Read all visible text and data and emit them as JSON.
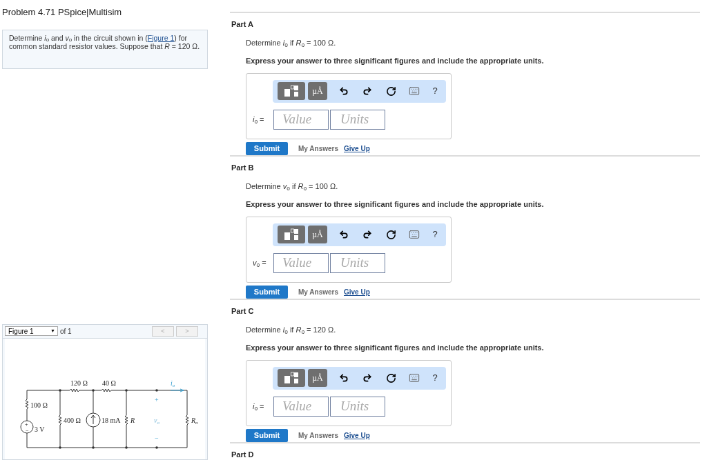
{
  "title": "Problem 4.71 PSpice|Multisim",
  "intro": {
    "before": "Determine *i*$_{o}$ and *v*$_{o}$ in the circuit shown in (",
    "link": "Figure 1",
    "after": ") for common standard resistor values. Suppose that *R* = 120 Ω."
  },
  "figure": {
    "select": "Figure 1",
    "caret": "▼",
    "count": "of 1",
    "prev": "<",
    "next": ">",
    "labels": [
      {
        "text": "120 Ω"
      },
      {
        "text": "40 Ω"
      },
      {
        "text": "100 Ω"
      },
      {
        "text": "3 V"
      },
      {
        "text": "400 Ω"
      },
      {
        "text": "18 mA"
      },
      {
        "text": "R"
      },
      {
        "text": "+"
      },
      {
        "text": "v",
        "sub": "o"
      },
      {
        "text": "−"
      },
      {
        "text": "R",
        "sub": "o"
      },
      {
        "text": "i",
        "sub": "o"
      },
      {
        "text": "+"
      },
      {
        "text": "−"
      }
    ]
  },
  "parts": [
    {
      "title": "Part A",
      "question": "Determine *i*$_{o}$ if *R*$_{o}$ = 100 Ω.",
      "instruction": "Express your answer to three significant figures and include the appropriate units.",
      "units_tool": "µÅ",
      "help": "?",
      "answer_label": "*i*$_{o}$ =",
      "value_placeholder": "Value",
      "units_placeholder": "Units",
      "submit": "Submit",
      "my_answers": "My Answers",
      "give_up": "Give Up"
    },
    {
      "title": "Part B",
      "question": "Determine *v*$_{o}$ if *R*$_{o}$ = 100 Ω.",
      "instruction": "Express your answer to three significant figures and include the appropriate units.",
      "units_tool": "µÅ",
      "help": "?",
      "answer_label": "*v*$_{o}$ =",
      "value_placeholder": "Value",
      "units_placeholder": "Units",
      "submit": "Submit",
      "my_answers": "My Answers",
      "give_up": "Give Up"
    },
    {
      "title": "Part C",
      "question": "Determine *i*$_{o}$ if *R*$_{o}$ = 120 Ω.",
      "instruction": "Express your answer to three significant figures and include the appropriate units.",
      "units_tool": "µÅ",
      "help": "?",
      "answer_label": "*i*$_{o}$ =",
      "value_placeholder": "Value",
      "units_placeholder": "Units",
      "submit": "Submit",
      "my_answers": "My Answers",
      "give_up": "Give Up"
    },
    {
      "title": "Part D"
    }
  ]
}
